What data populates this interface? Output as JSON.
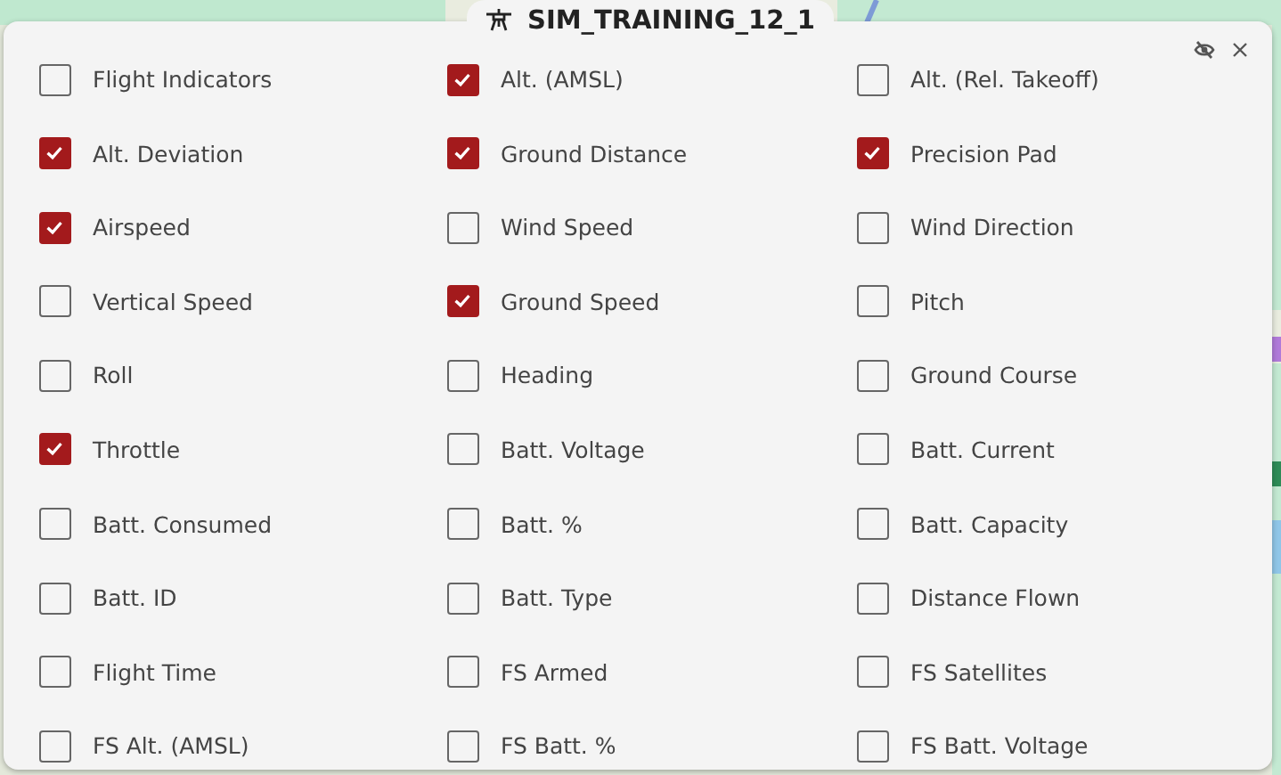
{
  "window": {
    "title": "SIM_TRAINING_12_1"
  },
  "items": [
    {
      "label": "Flight Indicators",
      "checked": false
    },
    {
      "label": "Alt. (AMSL)",
      "checked": true
    },
    {
      "label": "Alt. (Rel. Takeoff)",
      "checked": false
    },
    {
      "label": "Alt. Deviation",
      "checked": true
    },
    {
      "label": "Ground Distance",
      "checked": true
    },
    {
      "label": "Precision Pad",
      "checked": true
    },
    {
      "label": "Airspeed",
      "checked": true
    },
    {
      "label": "Wind Speed",
      "checked": false
    },
    {
      "label": "Wind Direction",
      "checked": false
    },
    {
      "label": "Vertical Speed",
      "checked": false
    },
    {
      "label": "Ground Speed",
      "checked": true
    },
    {
      "label": "Pitch",
      "checked": false
    },
    {
      "label": "Roll",
      "checked": false
    },
    {
      "label": "Heading",
      "checked": false
    },
    {
      "label": "Ground Course",
      "checked": false
    },
    {
      "label": "Throttle",
      "checked": true
    },
    {
      "label": "Batt. Voltage",
      "checked": false
    },
    {
      "label": "Batt. Current",
      "checked": false
    },
    {
      "label": "Batt. Consumed",
      "checked": false
    },
    {
      "label": "Batt. %",
      "checked": false
    },
    {
      "label": "Batt. Capacity",
      "checked": false
    },
    {
      "label": "Batt. ID",
      "checked": false
    },
    {
      "label": "Batt. Type",
      "checked": false
    },
    {
      "label": "Distance Flown",
      "checked": false
    },
    {
      "label": "Flight Time",
      "checked": false
    },
    {
      "label": "FS Armed",
      "checked": false
    },
    {
      "label": "FS Satellites",
      "checked": false
    },
    {
      "label": "FS Alt. (AMSL)",
      "checked": false
    },
    {
      "label": "FS Batt. %",
      "checked": false
    },
    {
      "label": "FS Batt. Voltage",
      "checked": false
    }
  ]
}
